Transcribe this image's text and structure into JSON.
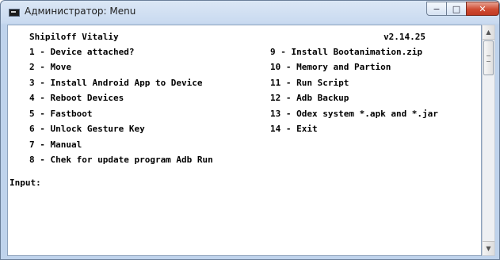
{
  "window": {
    "title": "Администратор:  Menu",
    "controls": {
      "minimize": "−",
      "maximize": "□",
      "close": "✕"
    }
  },
  "console": {
    "header_name": "Shipiloff Vitaliy",
    "version": "v2.14.25",
    "left_menu": [
      "1 - Device attached?",
      "2 - Move",
      "3 - Install Android App to Device",
      "4 - Reboot Devices",
      "5 - Fastboot",
      "6 - Unlock Gesture Key",
      "7 - Manual",
      "8 - Chek for update program Adb Run"
    ],
    "right_menu": [
      "9 - Install Bootanimation.zip",
      "10 - Memory and Partion",
      "11 - Run Script",
      "12 - Adb Backup",
      "13 - Odex system *.apk and *.jar",
      "14 - Exit"
    ],
    "prompt": "Input:"
  },
  "icons": {
    "window_icon": "console-window-icon",
    "scroll_up": "up-arrow-icon",
    "scroll_down": "down-arrow-icon"
  }
}
